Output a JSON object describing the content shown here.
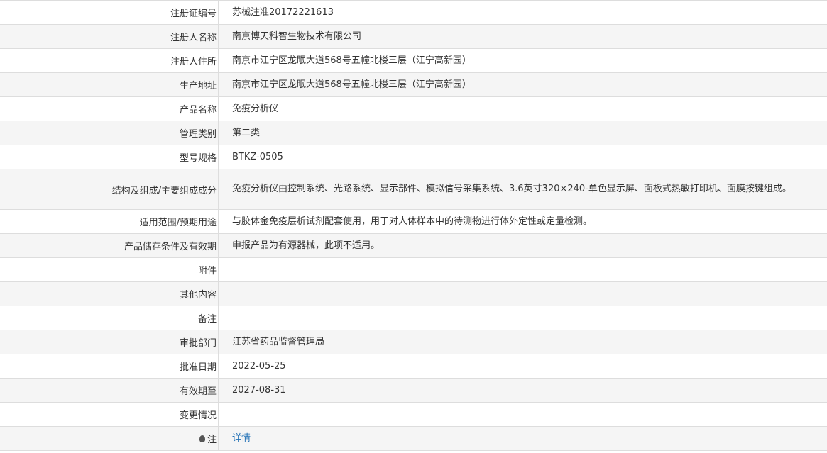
{
  "rows": [
    {
      "label": "注册证编号",
      "value": "苏械注准20172221613"
    },
    {
      "label": "注册人名称",
      "value": "南京博天科智生物技术有限公司"
    },
    {
      "label": "注册人住所",
      "value": "南京市江宁区龙眠大道568号五幢北楼三层（江宁高新园）"
    },
    {
      "label": "生产地址",
      "value": "南京市江宁区龙眠大道568号五幢北楼三层（江宁高新园）"
    },
    {
      "label": "产品名称",
      "value": "免疫分析仪"
    },
    {
      "label": "管理类别",
      "value": "第二类"
    },
    {
      "label": "型号规格",
      "value": "BTKZ-0505"
    },
    {
      "label": "结构及组成/主要组成成分",
      "value": "免疫分析仪由控制系统、光路系统、显示部件、模拟信号采集系统、3.6英寸320×240-单色显示屏、面板式热敏打印机、面膜按键组成。"
    },
    {
      "label": "适用范围/预期用途",
      "value": "与胶体金免疫层析试剂配套使用，用于对人体样本中的待测物进行体外定性或定量检测。"
    },
    {
      "label": "产品储存条件及有效期",
      "value": "申报产品为有源器械，此项不适用。"
    },
    {
      "label": "附件",
      "value": ""
    },
    {
      "label": "其他内容",
      "value": ""
    },
    {
      "label": "备注",
      "value": ""
    },
    {
      "label": "审批部门",
      "value": "江苏省药品监督管理局"
    },
    {
      "label": "批准日期",
      "value": "2022-05-25"
    },
    {
      "label": "有效期至",
      "value": "2027-08-31"
    },
    {
      "label": "变更情况",
      "value": ""
    }
  ],
  "note": {
    "label": "注",
    "icon": "lightbulb-icon",
    "link_text": "详情",
    "link_color": "#1f6fb5"
  }
}
